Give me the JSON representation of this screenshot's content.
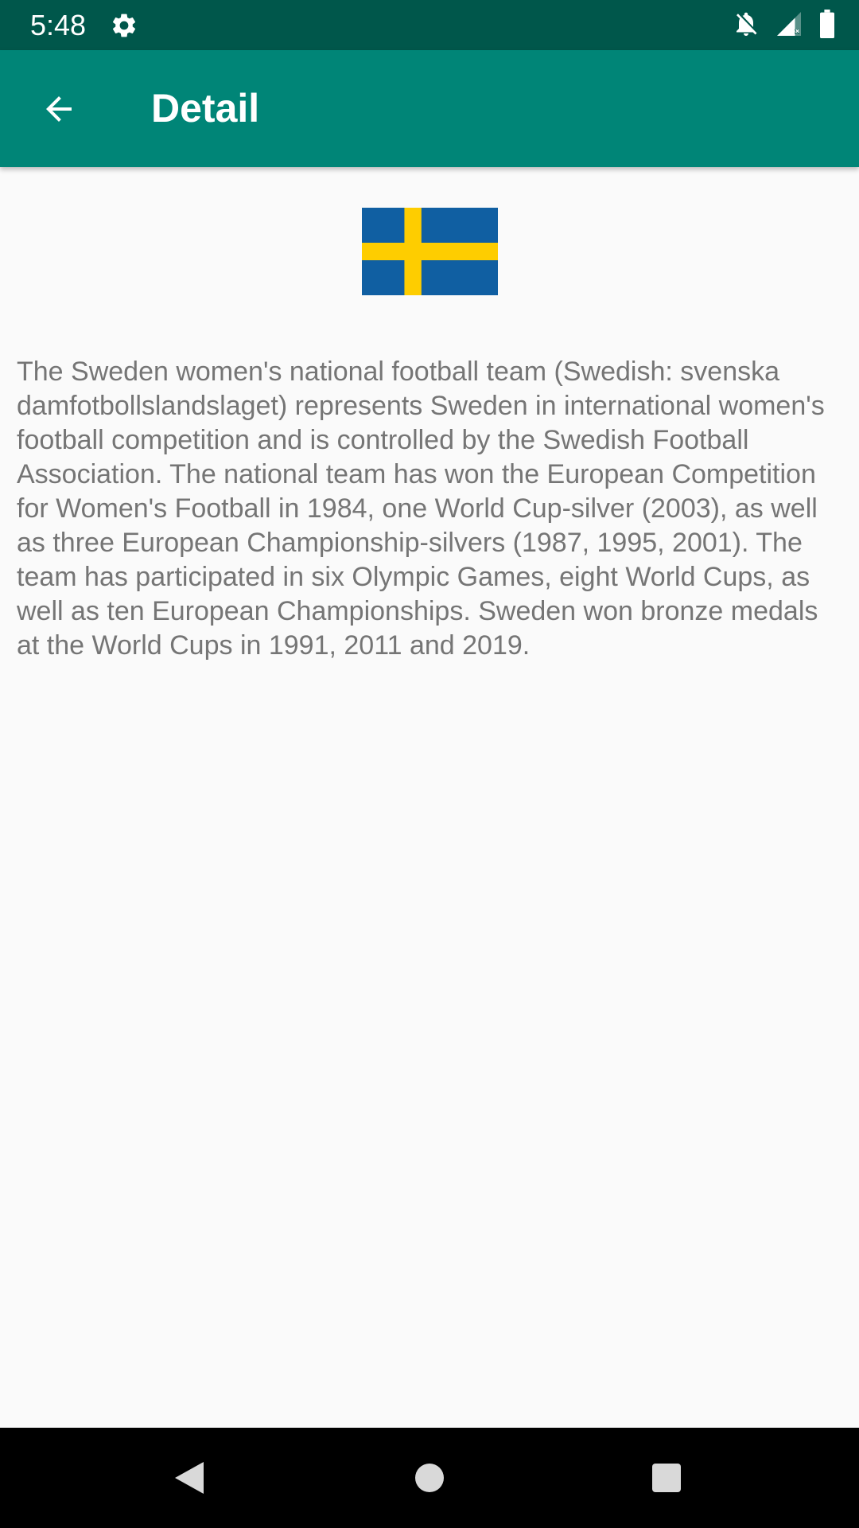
{
  "status_bar": {
    "time": "5:48",
    "icons": [
      "settings-icon",
      "notifications-off-icon",
      "signal-icon",
      "battery-icon"
    ],
    "background": "#00574b"
  },
  "app_bar": {
    "title": "Detail",
    "back_icon": "arrow-back-icon",
    "background": "#008577"
  },
  "content": {
    "flag": {
      "icon": "sweden-flag",
      "blue": "#105fa2",
      "yellow": "#fecd00"
    },
    "description": "The Sweden women's national football team (Swedish: svenska damfotbollslandslaget) represents Sweden in international women's football competition and is controlled by the Swedish Football Association. The national team has won the European Competition for Women's Football in 1984, one World Cup-silver (2003), as well as three European Championship-silvers (1987, 1995, 2001). The team has participated in six Olympic Games, eight World Cups, as well as ten European Championships. Sweden won bronze medals at the World Cups in 1991, 2011 and 2019."
  },
  "nav_bar": {
    "buttons": [
      "back-triangle-icon",
      "home-circle-icon",
      "recents-square-icon"
    ]
  }
}
